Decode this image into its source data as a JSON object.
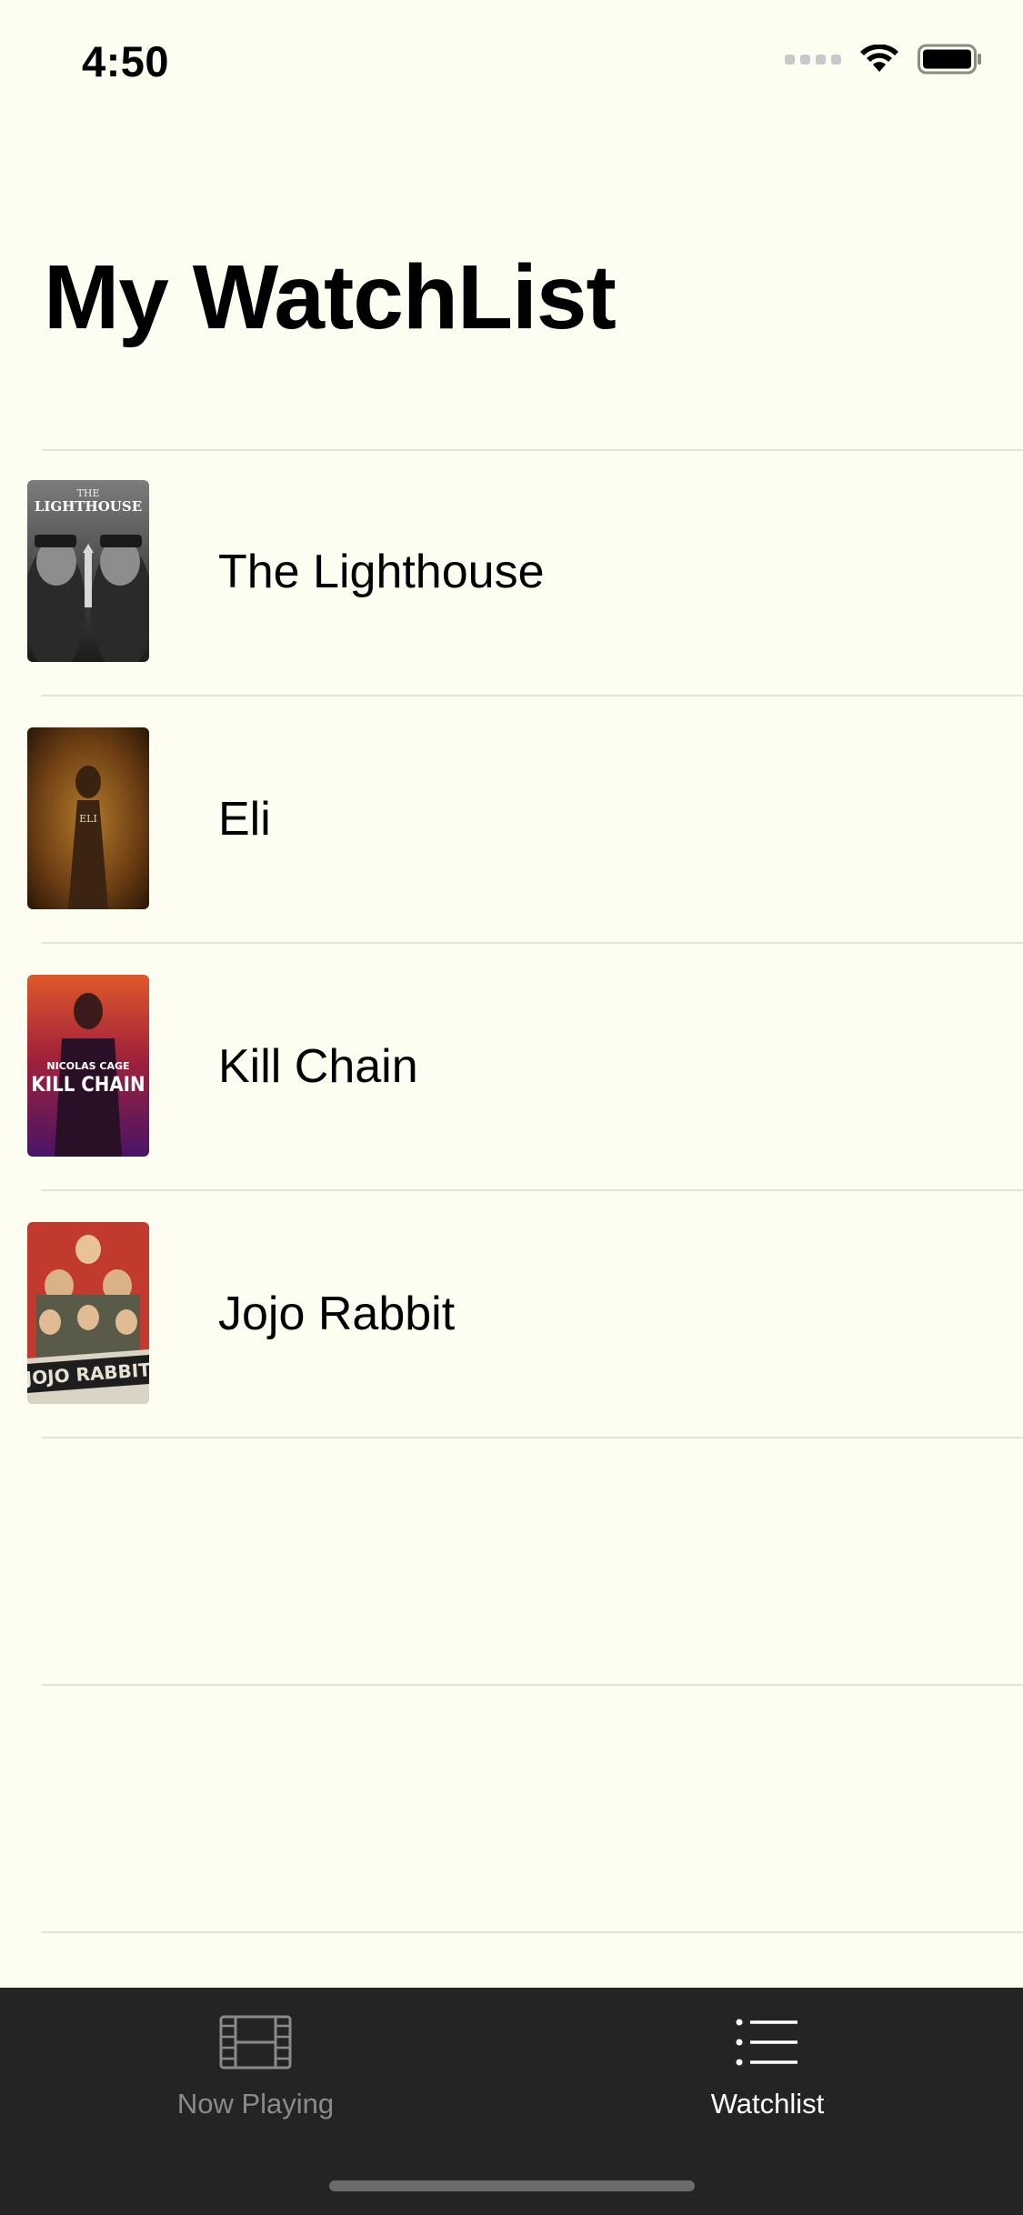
{
  "status_bar": {
    "time": "4:50"
  },
  "header": {
    "title": "My WatchList"
  },
  "movies": [
    {
      "title": "The Lighthouse",
      "poster_text": "THE LIGHTHOUSE"
    },
    {
      "title": "Eli",
      "poster_text": "ELI"
    },
    {
      "title": "Kill Chain",
      "poster_text": "NICOLAS CAGE KILL CHAIN"
    },
    {
      "title": "Jojo Rabbit",
      "poster_text": "JOJO RABBIT"
    }
  ],
  "tab_bar": {
    "tabs": [
      {
        "label": "Now Playing",
        "icon": "film-icon",
        "selected": false
      },
      {
        "label": "Watchlist",
        "icon": "list-icon",
        "selected": true
      }
    ]
  },
  "colors": {
    "background": "#fefdf1",
    "tab_bar": "#242424",
    "tab_selected": "#ffffff",
    "tab_unselected": "#8a8a8a"
  }
}
